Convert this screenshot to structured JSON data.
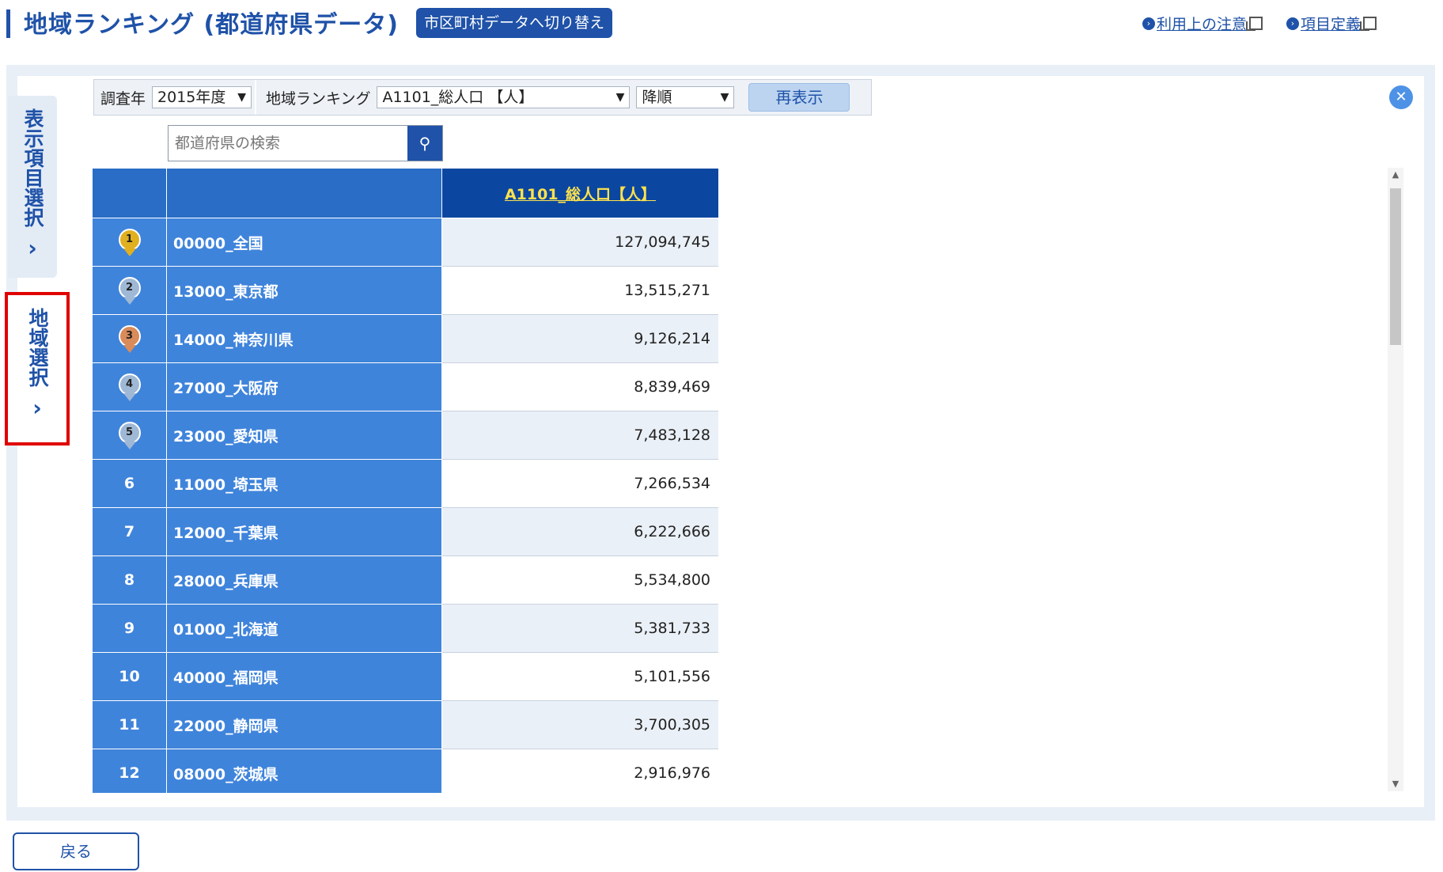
{
  "header": {
    "title": "地域ランキング (都道府県データ)",
    "switch_label": "市区町村データへ切り替え",
    "links": [
      "利用上の注意",
      "項目定義"
    ]
  },
  "side_tabs": {
    "display_items": "表示項目選択",
    "region_select": "地域選択"
  },
  "filters": {
    "year_label": "調査年",
    "year_value": "2015年度",
    "ranking_label": "地域ランキング",
    "ranking_value": "A1101_総人口 【人】",
    "order_value": "降順",
    "redisplay_label": "再表示"
  },
  "search": {
    "placeholder": "都道府県の検索"
  },
  "table": {
    "header_value": "A1101_総人口【人】",
    "rows": [
      {
        "rank": "1",
        "name": "00000_全国",
        "value": "127,094,745"
      },
      {
        "rank": "2",
        "name": "13000_東京都",
        "value": "13,515,271"
      },
      {
        "rank": "3",
        "name": "14000_神奈川県",
        "value": "9,126,214"
      },
      {
        "rank": "4",
        "name": "27000_大阪府",
        "value": "8,839,469"
      },
      {
        "rank": "5",
        "name": "23000_愛知県",
        "value": "7,483,128"
      },
      {
        "rank": "6",
        "name": "11000_埼玉県",
        "value": "7,266,534"
      },
      {
        "rank": "7",
        "name": "12000_千葉県",
        "value": "6,222,666"
      },
      {
        "rank": "8",
        "name": "28000_兵庫県",
        "value": "5,534,800"
      },
      {
        "rank": "9",
        "name": "01000_北海道",
        "value": "5,381,733"
      },
      {
        "rank": "10",
        "name": "40000_福岡県",
        "value": "5,101,556"
      },
      {
        "rank": "11",
        "name": "22000_静岡県",
        "value": "3,700,305"
      },
      {
        "rank": "12",
        "name": "08000_茨城県",
        "value": "2,916,976"
      }
    ]
  },
  "colors": {
    "medal_gold": "#e0b020",
    "medal_silver": "#9fb8d6",
    "medal_bronze": "#d98b5a"
  },
  "footer": {
    "back_label": "戻る"
  }
}
